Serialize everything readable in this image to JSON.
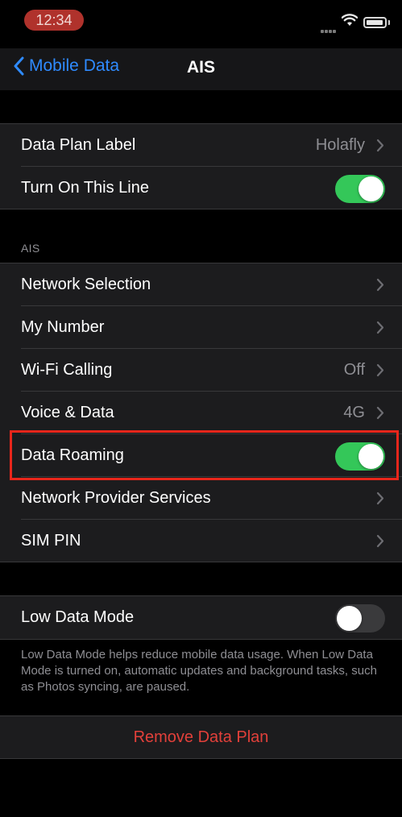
{
  "status": {
    "time": "12:34"
  },
  "nav": {
    "back_label": "Mobile Data",
    "title": "AIS"
  },
  "plan_group": {
    "data_plan_label": {
      "label": "Data Plan Label",
      "value": "Holafly"
    },
    "turn_on_line": {
      "label": "Turn On This Line",
      "enabled": true
    }
  },
  "ais_section": {
    "header": "AIS",
    "network_selection": {
      "label": "Network Selection"
    },
    "my_number": {
      "label": "My Number"
    },
    "wifi_calling": {
      "label": "Wi-Fi Calling",
      "value": "Off"
    },
    "voice_data": {
      "label": "Voice & Data",
      "value": "4G"
    },
    "data_roaming": {
      "label": "Data Roaming",
      "enabled": true
    },
    "network_provider_services": {
      "label": "Network Provider Services"
    },
    "sim_pin": {
      "label": "SIM PIN"
    }
  },
  "low_data": {
    "label": "Low Data Mode",
    "enabled": false,
    "footnote": "Low Data Mode helps reduce mobile data usage. When Low Data Mode is turned on, automatic updates and background tasks, such as Photos syncing, are paused."
  },
  "remove_plan": {
    "label": "Remove Data Plan"
  },
  "colors": {
    "accent": "#2f8bff",
    "toggle_on": "#34c759",
    "destructive": "#e2403a",
    "highlight": "#e8261b"
  }
}
